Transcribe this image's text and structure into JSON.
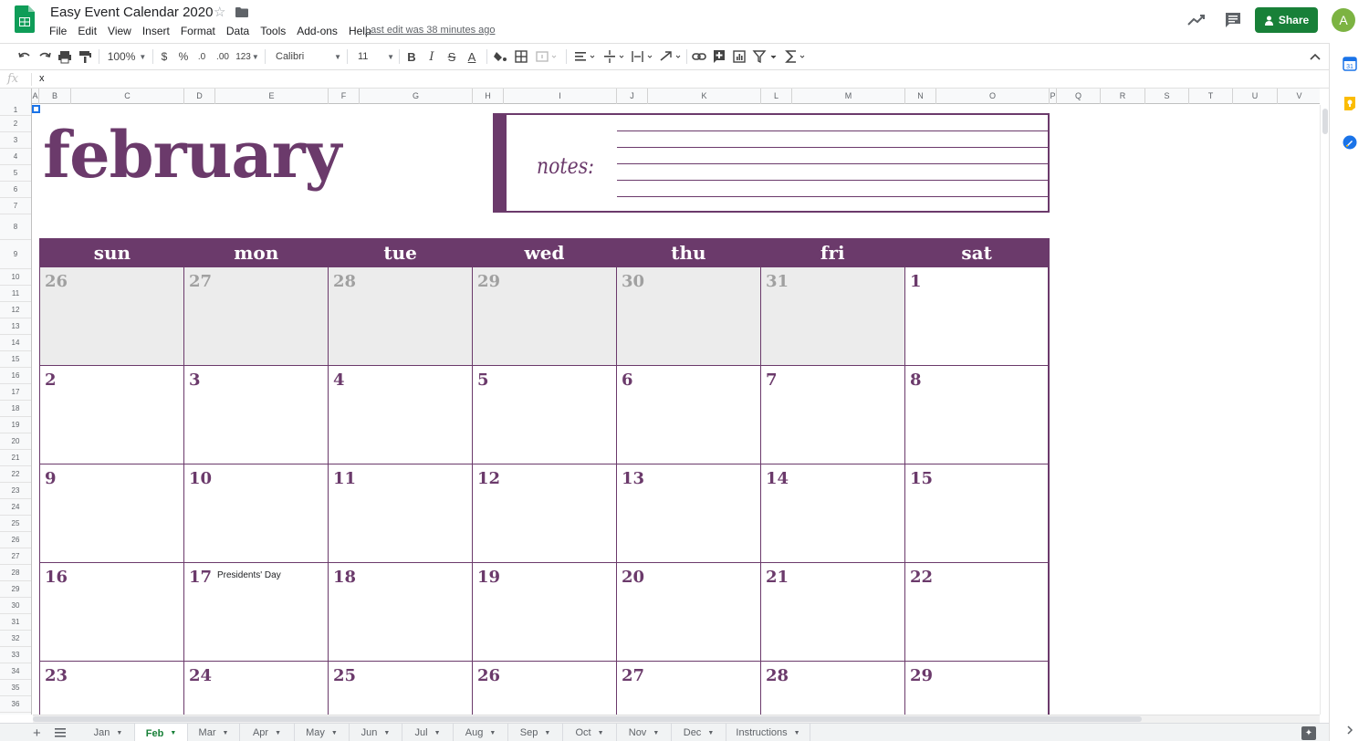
{
  "app": {
    "title": "Easy Event Calendar 2020",
    "last_edit": "Last edit was 38 minutes ago",
    "share_label": "Share",
    "avatar_letter": "A",
    "accent_color": "#188038",
    "calendar_color": "#6b3a6b"
  },
  "menu": [
    "File",
    "Edit",
    "View",
    "Insert",
    "Format",
    "Data",
    "Tools",
    "Add-ons",
    "Help"
  ],
  "toolbar": {
    "zoom": "100%",
    "currency": "$",
    "percent": "%",
    "decrease_decimal": ".0",
    "increase_decimal": ".00",
    "more_formats": "123",
    "font": "Calibri",
    "font_size": "11"
  },
  "formula_bar": {
    "fx": "fx",
    "value": "x"
  },
  "columns": [
    "A",
    "B",
    "C",
    "D",
    "E",
    "F",
    "G",
    "H",
    "I",
    "J",
    "K",
    "L",
    "M",
    "N",
    "O",
    "P",
    "Q",
    "R",
    "S",
    "T",
    "U",
    "V"
  ],
  "rows": [
    "1",
    "2",
    "3",
    "4",
    "5",
    "6",
    "7",
    "8",
    "9",
    "10",
    "11",
    "12",
    "13",
    "14",
    "15",
    "16",
    "17",
    "18",
    "19",
    "20",
    "21",
    "22",
    "23",
    "24",
    "25",
    "26",
    "27",
    "28",
    "29",
    "30",
    "31",
    "32",
    "33",
    "34",
    "35",
    "36"
  ],
  "calendar": {
    "month": "february",
    "notes_label": "notes:",
    "days_of_week": [
      "sun",
      "mon",
      "tue",
      "wed",
      "thu",
      "fri",
      "sat"
    ],
    "weeks": [
      [
        {
          "n": "26",
          "prev": true
        },
        {
          "n": "27",
          "prev": true
        },
        {
          "n": "28",
          "prev": true
        },
        {
          "n": "29",
          "prev": true
        },
        {
          "n": "30",
          "prev": true
        },
        {
          "n": "31",
          "prev": true
        },
        {
          "n": "1"
        }
      ],
      [
        {
          "n": "2"
        },
        {
          "n": "3"
        },
        {
          "n": "4"
        },
        {
          "n": "5"
        },
        {
          "n": "6"
        },
        {
          "n": "7"
        },
        {
          "n": "8"
        }
      ],
      [
        {
          "n": "9"
        },
        {
          "n": "10"
        },
        {
          "n": "11"
        },
        {
          "n": "12"
        },
        {
          "n": "13"
        },
        {
          "n": "14"
        },
        {
          "n": "15"
        }
      ],
      [
        {
          "n": "16"
        },
        {
          "n": "17",
          "event": "Presidents' Day"
        },
        {
          "n": "18"
        },
        {
          "n": "19"
        },
        {
          "n": "20"
        },
        {
          "n": "21"
        },
        {
          "n": "22"
        }
      ],
      [
        {
          "n": "23"
        },
        {
          "n": "24"
        },
        {
          "n": "25"
        },
        {
          "n": "26"
        },
        {
          "n": "27"
        },
        {
          "n": "28"
        },
        {
          "n": "29"
        }
      ]
    ]
  },
  "sheet_tabs": [
    "Jan",
    "Feb",
    "Mar",
    "Apr",
    "May",
    "Jun",
    "Jul",
    "Aug",
    "Sep",
    "Oct",
    "Nov",
    "Dec",
    "Instructions"
  ],
  "active_sheet": "Feb"
}
